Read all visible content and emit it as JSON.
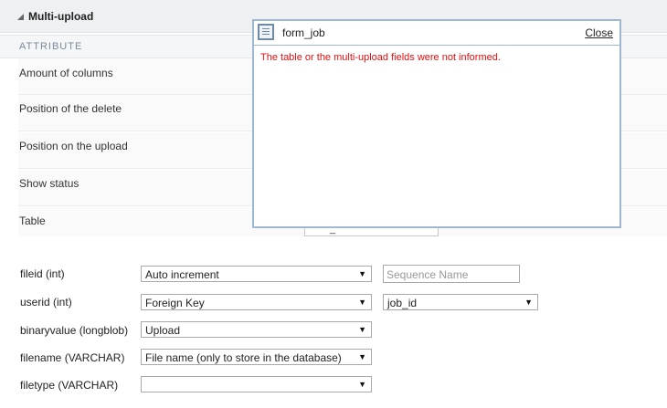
{
  "section": {
    "title": "Multi-upload",
    "subtitle": "ATTRIBUTE"
  },
  "attributes": [
    {
      "label": "Amount of columns"
    },
    {
      "label": "Position of the delete"
    },
    {
      "label": "Position on the upload"
    },
    {
      "label": "Show status"
    },
    {
      "label": "Table"
    }
  ],
  "table_value": "_",
  "fields": [
    {
      "label": "fileid (int)",
      "select": "Auto increment",
      "extra_input_placeholder": "Sequence Name"
    },
    {
      "label": "userid (int)",
      "select": "Foreign Key",
      "extra_select": "job_id"
    },
    {
      "label": "binaryvalue (longblob)",
      "select": "Upload"
    },
    {
      "label": "filename (VARCHAR)",
      "select": "File name (only to store in the database)"
    },
    {
      "label": "filetype (VARCHAR)",
      "select": ""
    }
  ],
  "dialog": {
    "title": "form_job",
    "close_label": "Close",
    "message": "The table or the multi-upload fields were not informed."
  },
  "icons": {
    "dropdown": "▼"
  },
  "colors": {
    "error": "#e01010",
    "dialog_border": "#9fb8d2"
  }
}
